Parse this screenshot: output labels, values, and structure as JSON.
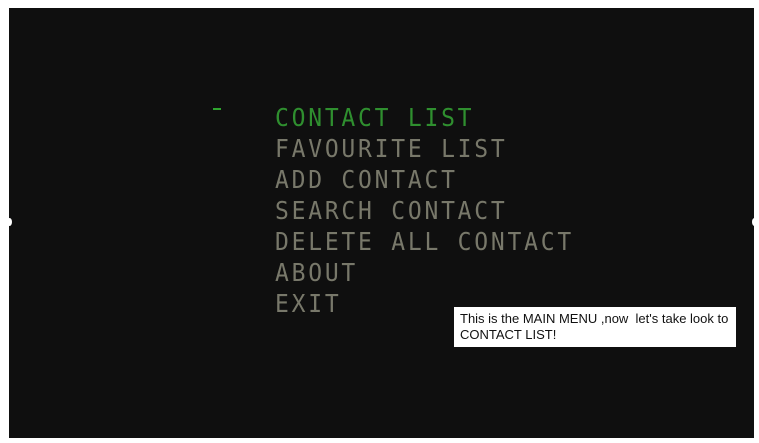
{
  "menu": {
    "items": [
      {
        "label": "CONTACT LIST",
        "selected": true
      },
      {
        "label": "FAVOURITE LIST",
        "selected": false
      },
      {
        "label": "ADD CONTACT",
        "selected": false
      },
      {
        "label": "SEARCH CONTACT",
        "selected": false
      },
      {
        "label": "DELETE ALL CONTACT",
        "selected": false
      },
      {
        "label": "ABOUT",
        "selected": false
      },
      {
        "label": "EXIT",
        "selected": false
      }
    ],
    "selected_color": "#2f8f2f",
    "item_color": "#78786a"
  },
  "tooltip": {
    "text": "This is the MAIN MENU ,now  let's take look to CONTACT LIST!"
  },
  "colors": {
    "background": "#0f0f0f",
    "cursor": "#2fa52f"
  }
}
